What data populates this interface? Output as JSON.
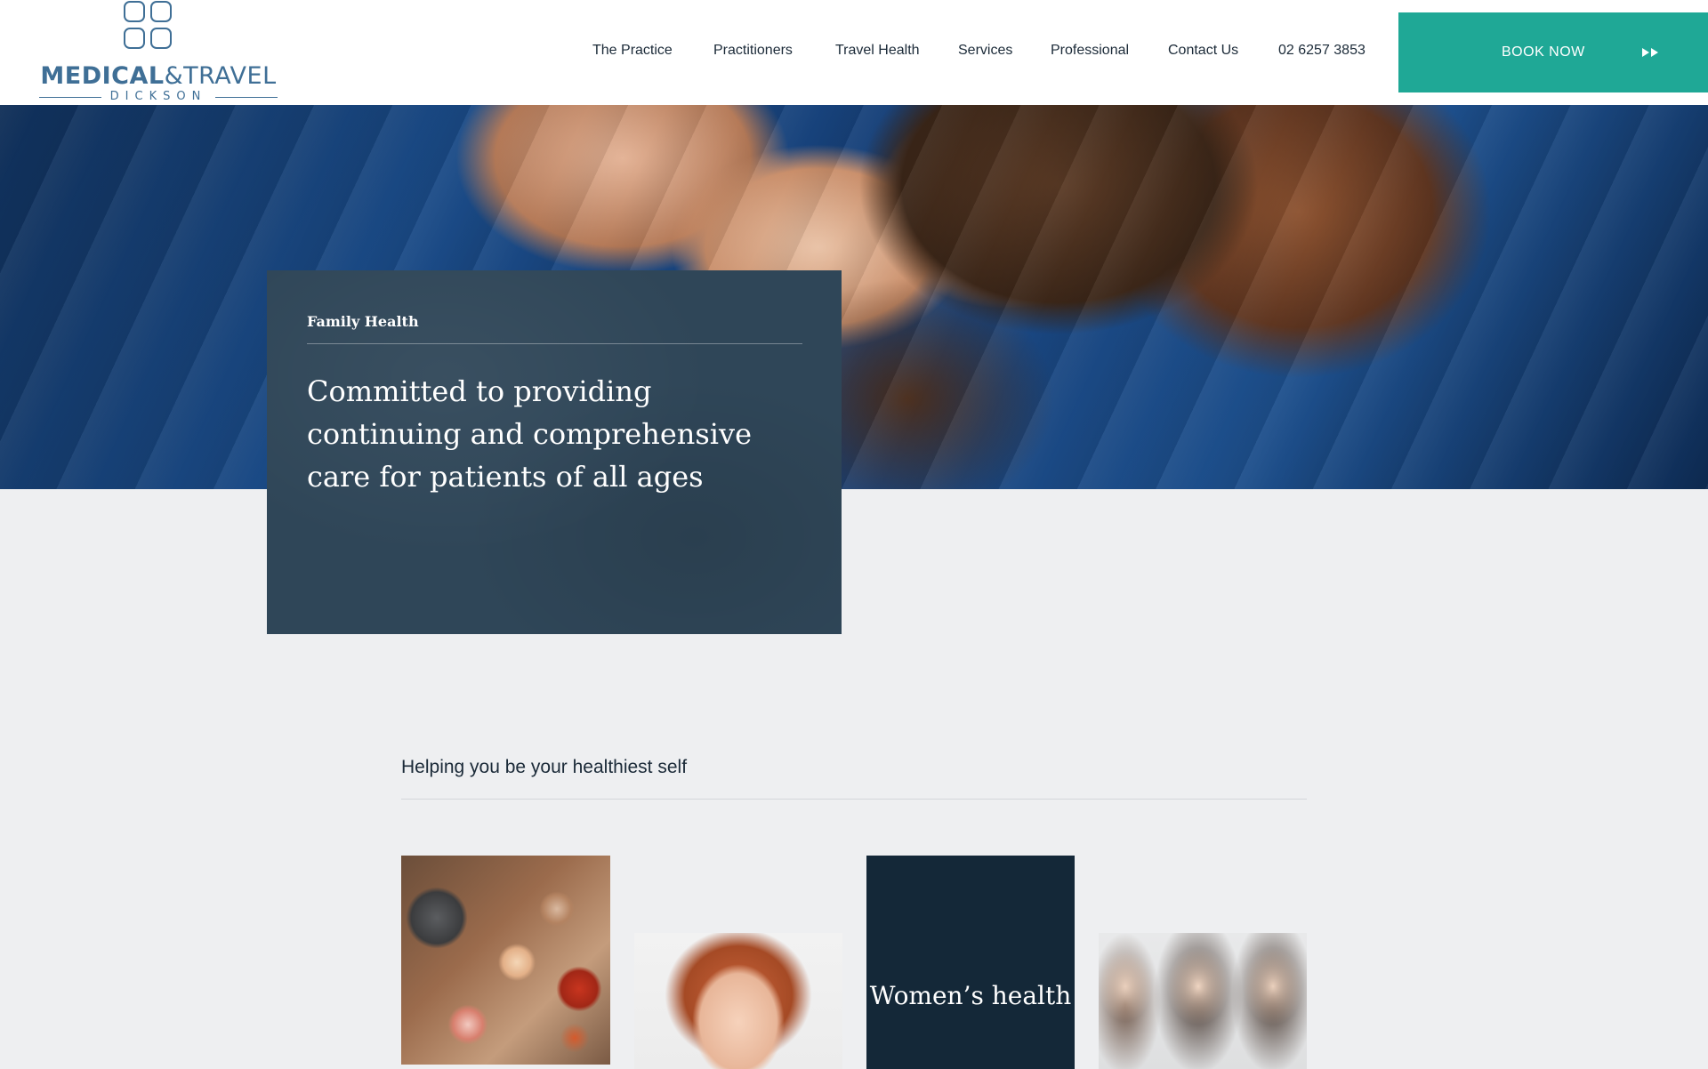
{
  "brand": {
    "name_part1": "MEDICAL",
    "name_part2": "&TRAVEL",
    "name_sub": "DICKSON"
  },
  "nav": {
    "items": [
      "The Practice",
      "Practitioners",
      "Travel Health",
      "Services",
      "Professional",
      "Contact Us"
    ],
    "phone": "02 6257 3853",
    "book_label": "BOOK NOW"
  },
  "hero": {
    "kicker": "Family Health",
    "headline": "Committed to providing continuing and comprehensive care for patients of all ages"
  },
  "section": {
    "title": "Helping you be your healthiest self",
    "tiles": [
      {
        "label": ""
      },
      {
        "label": ""
      },
      {
        "label": "Women’s health"
      },
      {
        "label": ""
      }
    ]
  },
  "colors": {
    "accent": "#1fa896",
    "brand_blue": "#3f6f96",
    "card_bg": "#2f4658",
    "tile_dark": "#142838",
    "page_bg": "#eeeff1"
  }
}
